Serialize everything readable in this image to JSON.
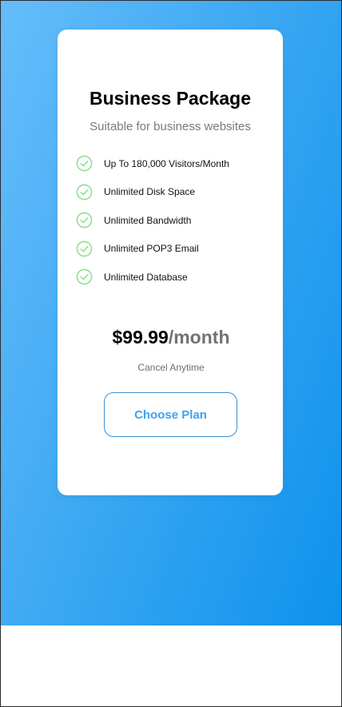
{
  "plan": {
    "title": "Business Package",
    "subtitle": "Suitable for business websites",
    "features": [
      {
        "label": "Up To 180,000 Visitors/Month",
        "icon": "check-circle-icon"
      },
      {
        "label": "Unlimited Disk Space",
        "icon": "check-circle-icon"
      },
      {
        "label": "Unlimited Bandwidth",
        "icon": "check-circle-icon"
      },
      {
        "label": "Unlimited POP3 Email",
        "icon": "check-circle-icon"
      },
      {
        "label": "Unlimited Database",
        "icon": "check-circle-icon"
      }
    ],
    "price": {
      "amount": "$99.99",
      "period": "/month"
    },
    "cancel_note": "Cancel Anytime",
    "cta_label": "Choose Plan"
  },
  "colors": {
    "gradient_start": "#66bdfb",
    "gradient_end": "#0d92ec",
    "check_green": "#8ee08b",
    "cta_text": "#3fa2ea",
    "cta_border": "#3c8fd0"
  }
}
